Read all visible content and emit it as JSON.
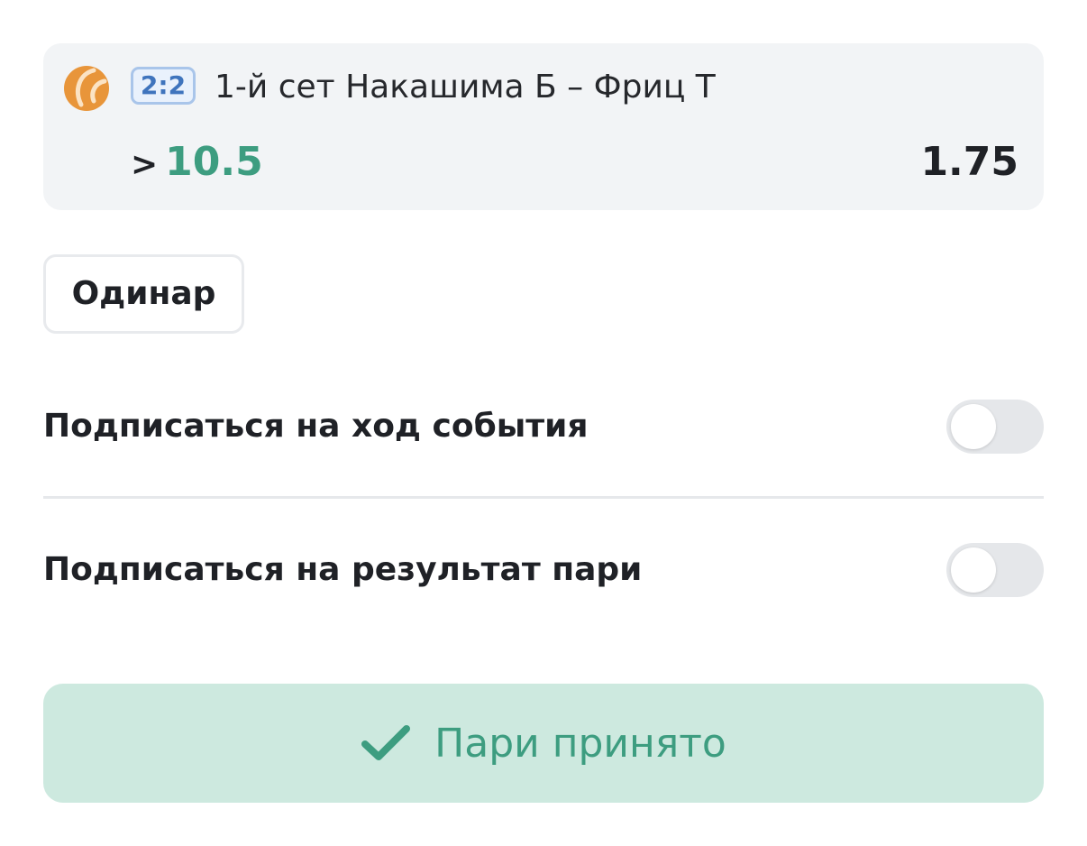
{
  "bet": {
    "sport_icon": "tennis-ball-icon",
    "score": "2:2",
    "event": "1-й сет Накашима Б – Фриц Т",
    "operator": ">",
    "line": "10.5",
    "odds": "1.75"
  },
  "bet_type": "Одинар",
  "subscriptions": [
    {
      "label": "Подписаться на ход события",
      "enabled": false
    },
    {
      "label": "Подписаться на результат пари",
      "enabled": false
    }
  ],
  "accept_button": {
    "icon": "checkmark-icon",
    "label": "Пари принято"
  },
  "colors": {
    "card_bg": "#f2f4f6",
    "accent_green": "#3d9d80",
    "accept_bg": "#cde9df",
    "badge_blue": "#3f74bd",
    "ball_orange": "#e8953a"
  }
}
